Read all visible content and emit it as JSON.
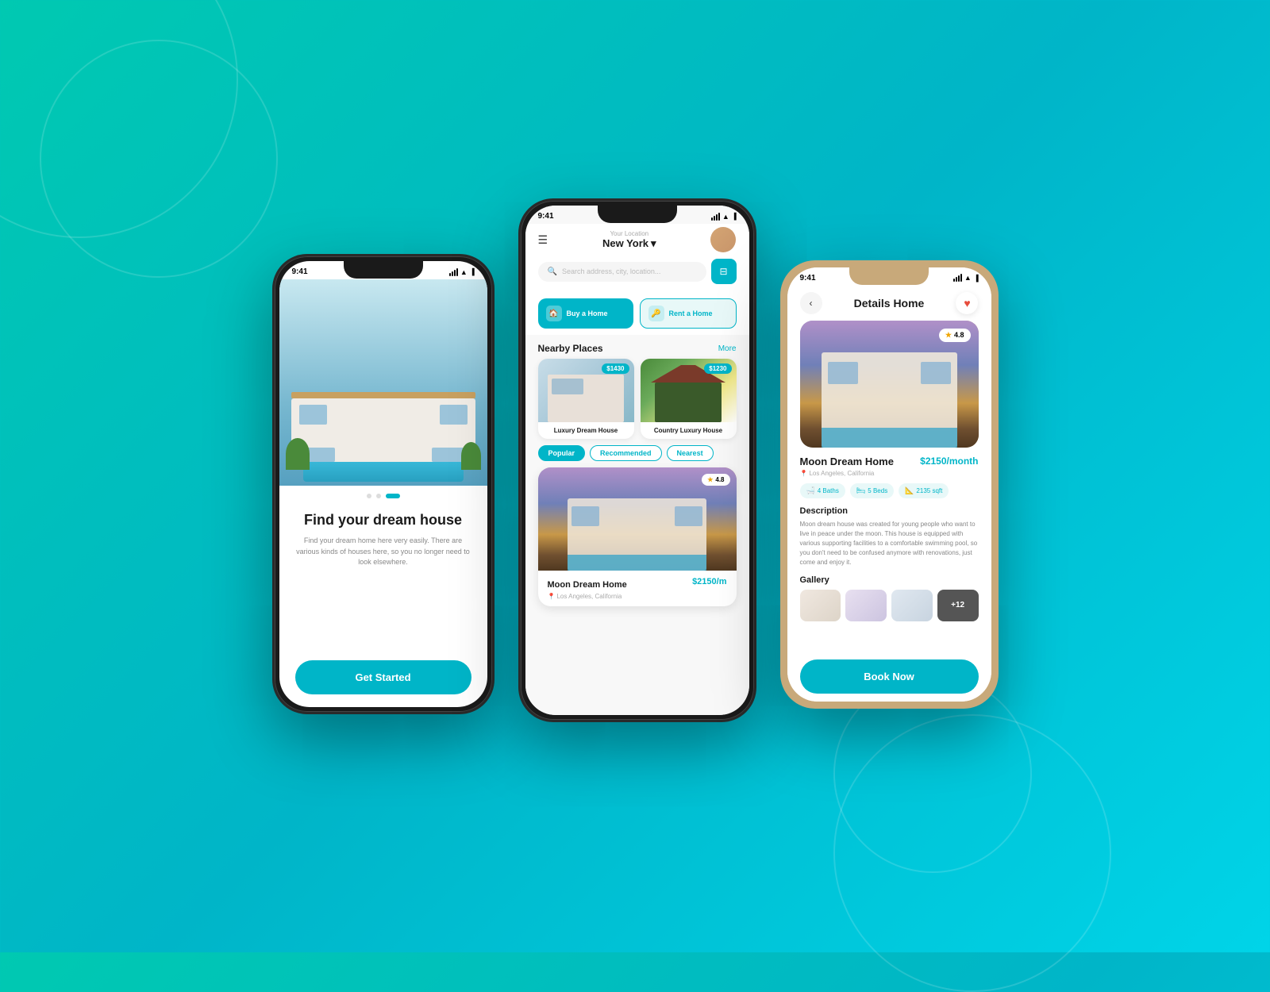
{
  "background": {
    "gradient_start": "#00c9b1",
    "gradient_end": "#00d4e8"
  },
  "phone1": {
    "status": {
      "time": "9:41",
      "signal": "●●●",
      "wifi": "wifi",
      "battery": "battery"
    },
    "hero_alt": "Modern villa with pool",
    "dots": [
      "inactive",
      "inactive",
      "active"
    ],
    "title": "Find your dream house",
    "subtitle": "Find your dream home here very easily. There are various kinds of houses here, so you no longer need to look elsewhere.",
    "cta_button": "Get Started"
  },
  "phone2": {
    "status": {
      "time": "9:41"
    },
    "location_label": "Your Location",
    "location_city": "New York",
    "search_placeholder": "Search address, city, location...",
    "buttons": {
      "buy": "Buy a Home",
      "rent": "Rent a Home"
    },
    "nearby": {
      "title": "Nearby Places",
      "more_label": "More",
      "cards": [
        {
          "name": "Luxury Dream House",
          "price": "$1430",
          "img_type": "modern"
        },
        {
          "name": "Country Luxury House",
          "price": "$1230",
          "img_type": "cottage"
        }
      ]
    },
    "filter_tabs": [
      "Popular",
      "Recommended",
      "Nearest"
    ],
    "active_tab": 0,
    "featured": {
      "name": "Moon Dream Home",
      "price": "$2150/m",
      "location": "Los Angeles, California",
      "rating": "4.8",
      "img_type": "luxury"
    }
  },
  "phone3": {
    "status": {
      "time": "9:41"
    },
    "header_title": "Details Home",
    "back_label": "‹",
    "heart_icon": "♥",
    "property": {
      "name": "Moon Dream Home",
      "price": "$2150/month",
      "location": "Los Angeles, California",
      "rating": "4.8",
      "amenities": [
        {
          "icon": "🛁",
          "label": "4 Baths"
        },
        {
          "icon": "🛏",
          "label": "5 Beds"
        },
        {
          "icon": "📐",
          "label": "2135 sqft"
        }
      ]
    },
    "description": {
      "title": "Description",
      "text": "Moon dream house was created for young people who want to live in peace under the moon. This house is equipped with various supporting facilities to a comfortable swimming pool, so you don't need to be confused anymore with renovations, just come and enjoy it."
    },
    "gallery": {
      "title": "Gallery",
      "thumbs": [
        "interior1",
        "interior2",
        "interior3"
      ],
      "more_count": "+12"
    },
    "book_button": "Book Now"
  }
}
